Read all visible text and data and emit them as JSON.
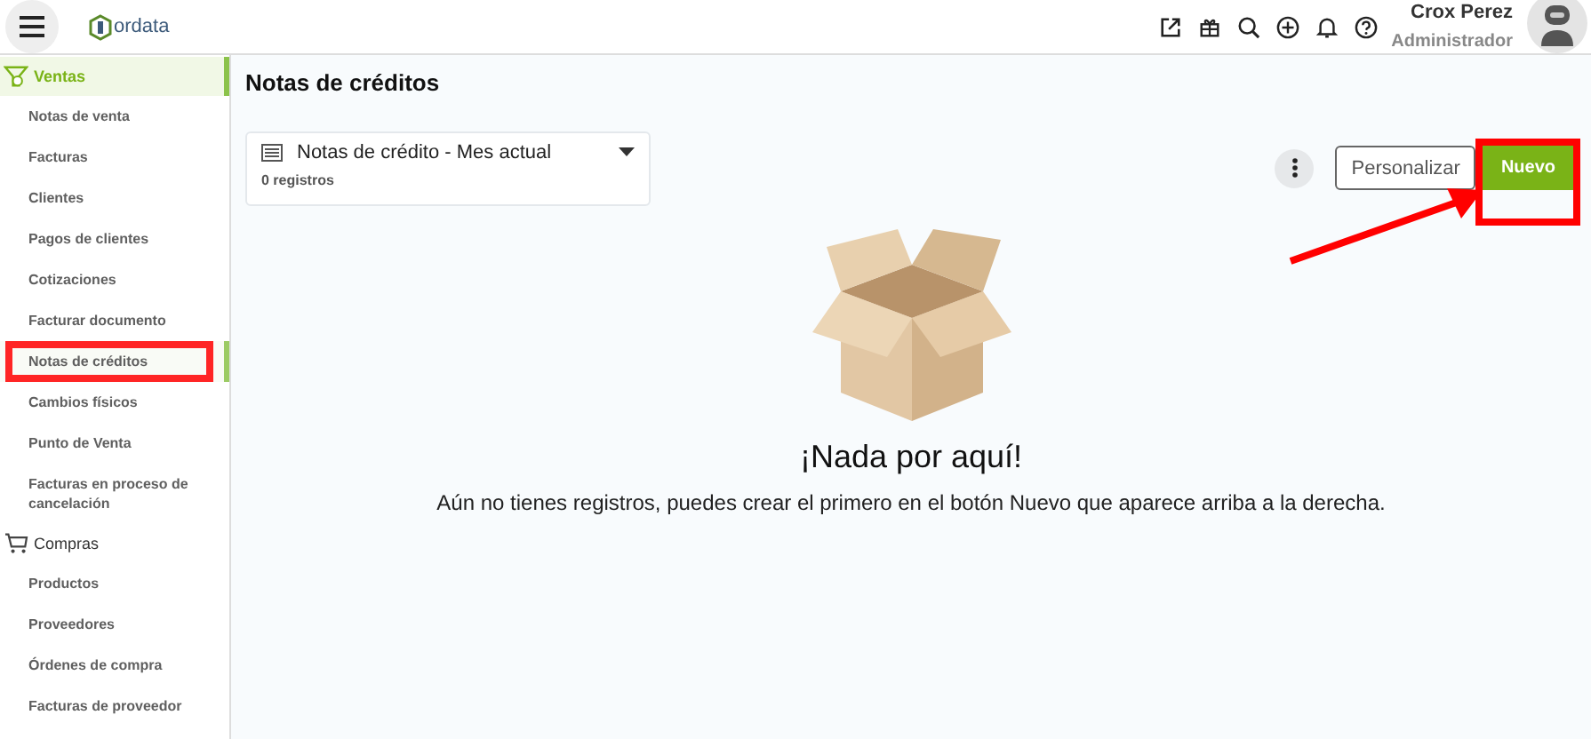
{
  "topbar": {
    "logo": "ordata",
    "user": {
      "name": "Crox Perez",
      "role": "Administrador"
    }
  },
  "sidebar": {
    "sections": [
      {
        "kind": "sales",
        "label": "Ventas",
        "selected": true,
        "items": [
          {
            "label": "Notas de venta",
            "selected": false,
            "highlighted": false
          },
          {
            "label": "Facturas",
            "selected": false,
            "highlighted": false
          },
          {
            "label": "Clientes",
            "selected": false,
            "highlighted": false
          },
          {
            "label": "Pagos de clientes",
            "selected": false,
            "highlighted": false
          },
          {
            "label": "Cotizaciones",
            "selected": false,
            "highlighted": false
          },
          {
            "label": "Facturar documento",
            "selected": false,
            "highlighted": false
          },
          {
            "label": "Notas de créditos",
            "selected": true,
            "highlighted": true
          },
          {
            "label": "Cambios físicos",
            "selected": false,
            "highlighted": false
          },
          {
            "label": "Punto de Venta",
            "selected": false,
            "highlighted": false
          },
          {
            "label": "Facturas en proceso de cancelación",
            "selected": false,
            "highlighted": false
          }
        ]
      },
      {
        "kind": "purchases",
        "label": "Compras",
        "selected": false,
        "items": [
          {
            "label": "Productos",
            "selected": false,
            "highlighted": false
          },
          {
            "label": "Proveedores",
            "selected": false,
            "highlighted": false
          },
          {
            "label": "Órdenes de compra",
            "selected": false,
            "highlighted": false
          },
          {
            "label": "Facturas de proveedor",
            "selected": false,
            "highlighted": false
          }
        ]
      }
    ]
  },
  "page": {
    "title": "Notas de créditos",
    "view": {
      "label": "Notas de crédito - Mes actual",
      "count": "0 registros"
    },
    "buttons": [
      {
        "kind": "secondary",
        "label": "Personalizar",
        "highlighted": false
      },
      {
        "kind": "primary",
        "label": "Nuevo",
        "highlighted": true
      }
    ],
    "empty": {
      "title": "¡Nada por aquí!",
      "message": "Aún no tienes registros, puedes crear el primero en el botón Nuevo que aparece arriba a la derecha."
    }
  }
}
